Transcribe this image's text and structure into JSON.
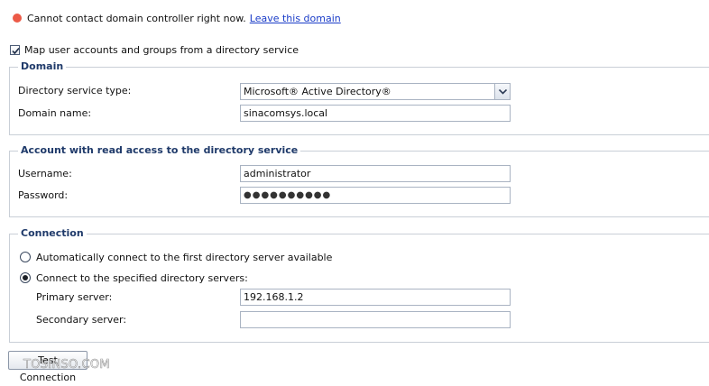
{
  "status": {
    "message": "Cannot contact domain controller right now.",
    "link": "Leave this domain",
    "dot_color": "#ec5a47"
  },
  "map_accounts": {
    "label": "Map user accounts and groups from a directory service",
    "checked": true
  },
  "domain": {
    "legend": "Domain",
    "type_label": "Directory service type:",
    "type_value": "Microsoft® Active Directory®",
    "name_label": "Domain name:",
    "name_value": "sinacomsys.local"
  },
  "account": {
    "legend": "Account with read access to the directory service",
    "username_label": "Username:",
    "username_value": "administrator",
    "password_label": "Password:",
    "password_value": "●●●●●●●●●●"
  },
  "connection": {
    "legend": "Connection",
    "auto_label": "Automatically connect to the first directory server available",
    "specified_label": "Connect to the specified directory servers:",
    "selected": "specified",
    "primary_label": "Primary server:",
    "primary_value": "192.168.1.2",
    "secondary_label": "Secondary server:",
    "secondary_value": ""
  },
  "test_button": "Test Connection",
  "watermark": "TOSINSO.COM",
  "icons": {
    "status": "status-dot-icon",
    "check": "checkmark-icon",
    "dropdown": "chevron-down-icon"
  }
}
